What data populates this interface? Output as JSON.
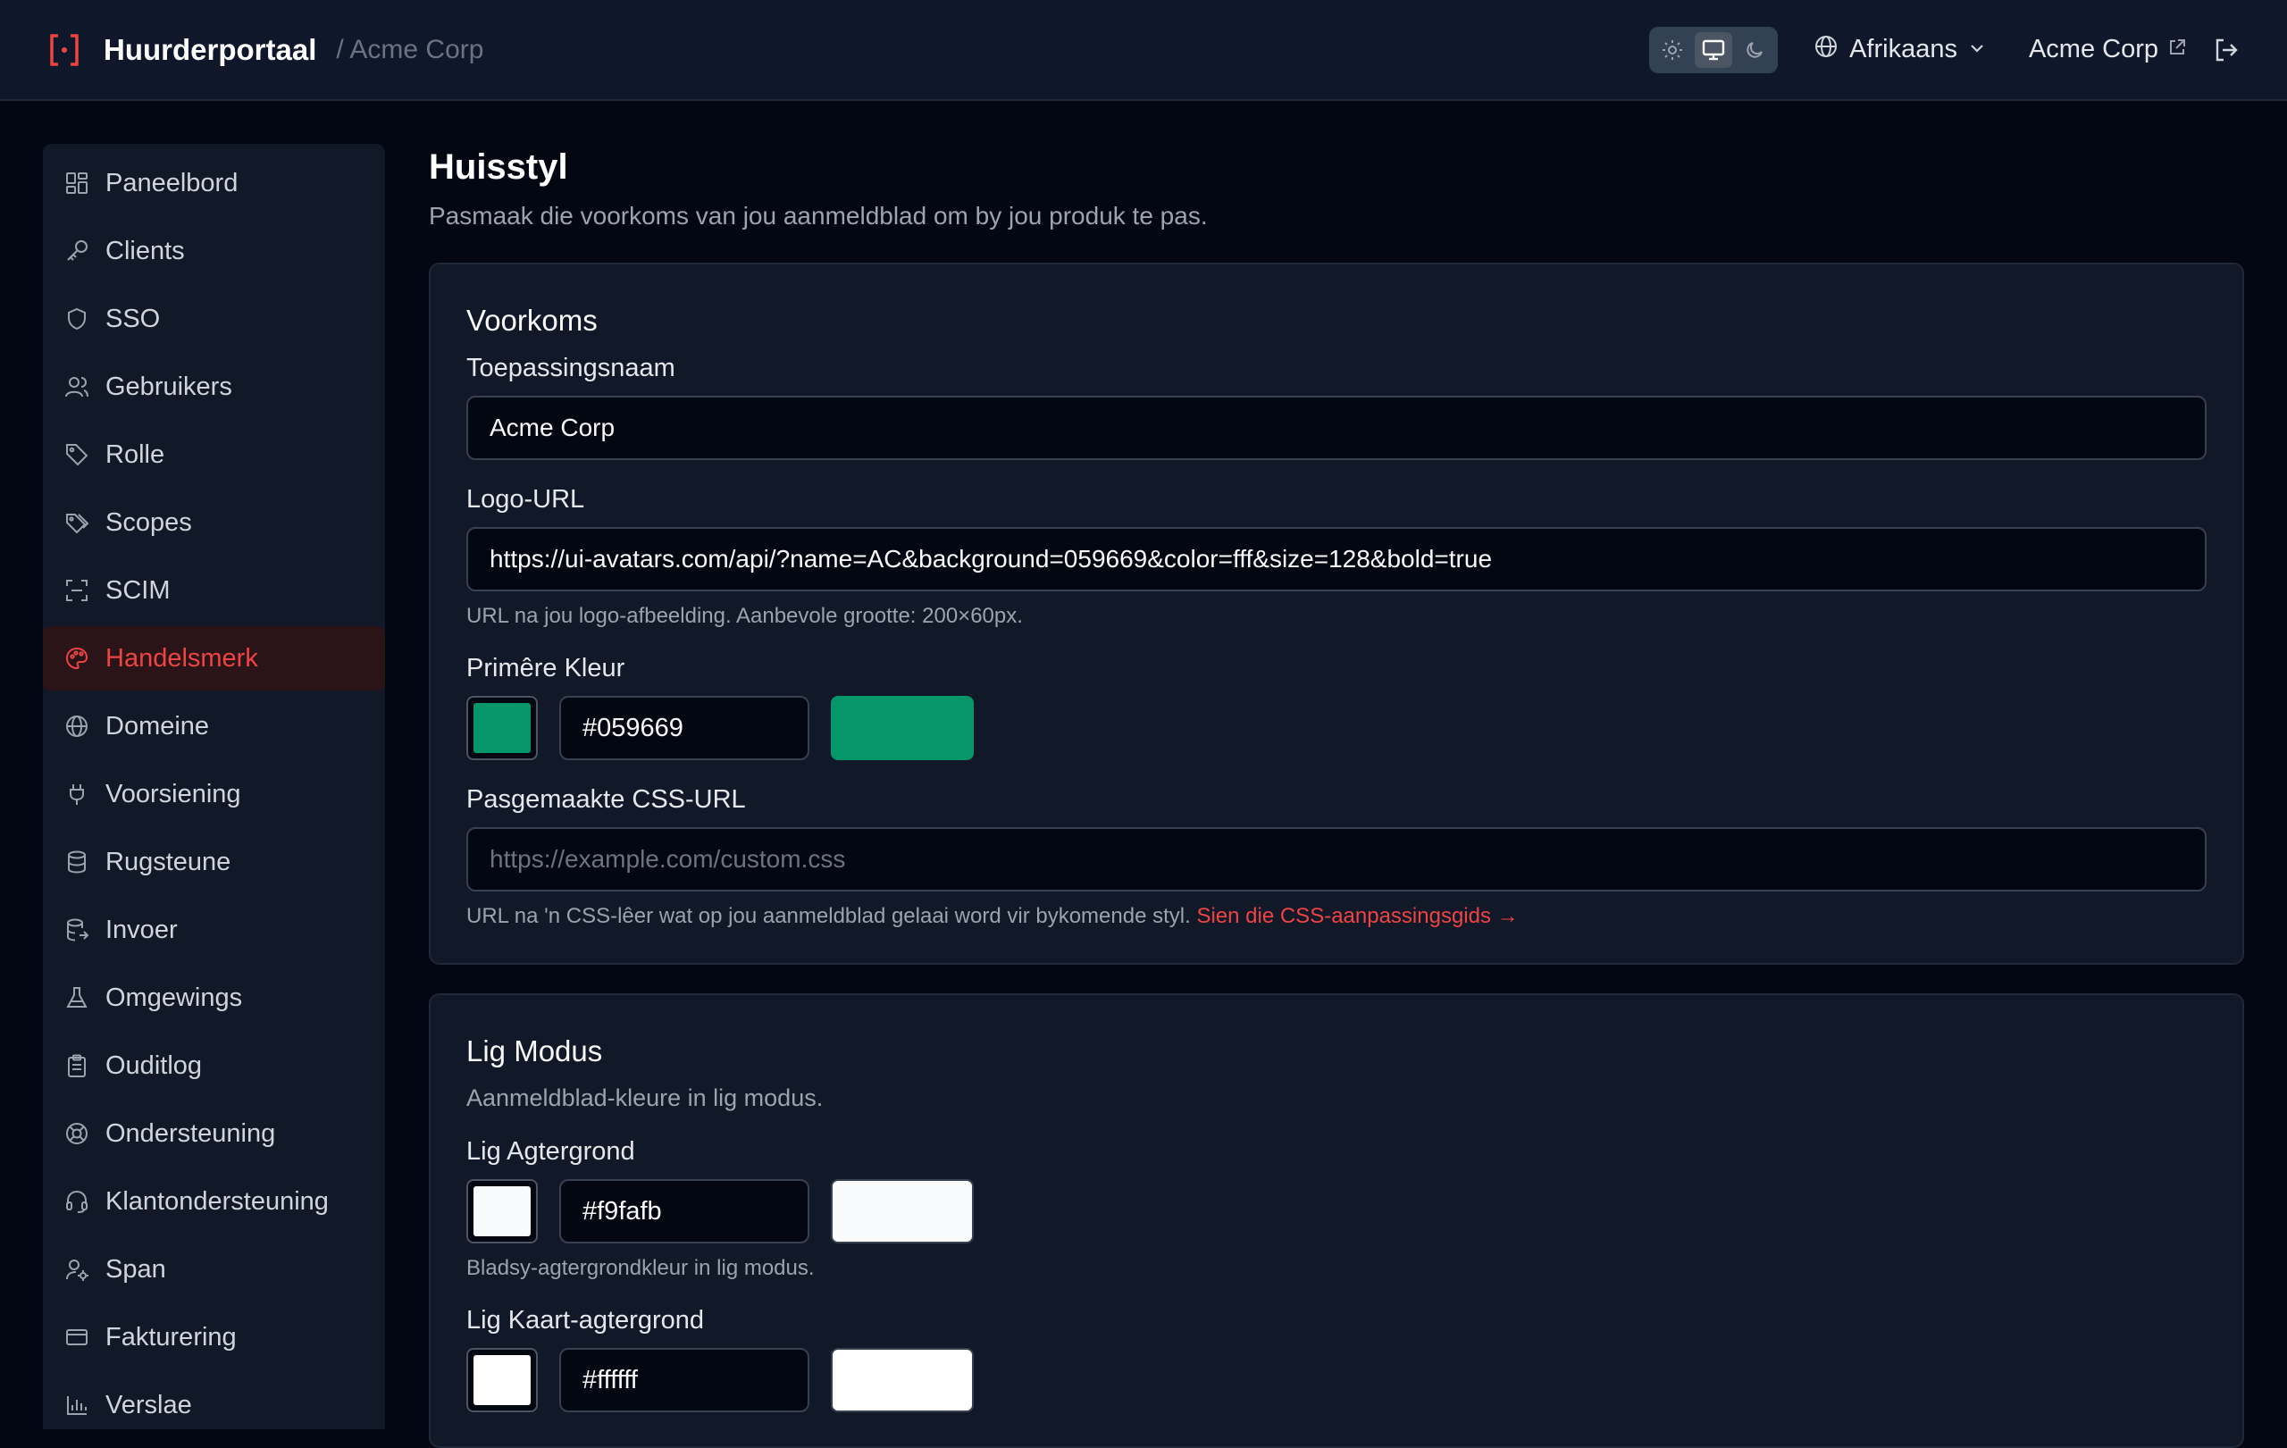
{
  "header": {
    "brand": "Huurderportaal",
    "breadcrumb": "/ Acme Corp",
    "language": "Afrikaans",
    "tenant": "Acme Corp",
    "accent": "#ef4444"
  },
  "sidebar": {
    "items": [
      {
        "label": "Paneelbord",
        "icon": "dashboard-icon"
      },
      {
        "label": "Clients",
        "icon": "key-icon"
      },
      {
        "label": "SSO",
        "icon": "shield-icon"
      },
      {
        "label": "Gebruikers",
        "icon": "users-icon"
      },
      {
        "label": "Rolle",
        "icon": "tag-icon"
      },
      {
        "label": "Scopes",
        "icon": "tags-icon"
      },
      {
        "label": "SCIM",
        "icon": "scan-icon"
      },
      {
        "label": "Handelsmerk",
        "icon": "palette-icon",
        "active": true
      },
      {
        "label": "Domeine",
        "icon": "globe-icon"
      },
      {
        "label": "Voorsiening",
        "icon": "plug-icon"
      },
      {
        "label": "Rugsteune",
        "icon": "database-icon"
      },
      {
        "label": "Invoer",
        "icon": "database-import-icon"
      },
      {
        "label": "Omgewings",
        "icon": "flask-icon"
      },
      {
        "label": "Ouditlog",
        "icon": "clipboard-icon"
      },
      {
        "label": "Ondersteuning",
        "icon": "lifebuoy-icon"
      },
      {
        "label": "Klantondersteuning",
        "icon": "headset-icon"
      },
      {
        "label": "Span",
        "icon": "user-cog-icon"
      },
      {
        "label": "Fakturering",
        "icon": "credit-card-icon"
      },
      {
        "label": "Verslae",
        "icon": "bar-chart-icon"
      }
    ]
  },
  "page": {
    "title": "Huisstyl",
    "subtitle": "Pasmaak die voorkoms van jou aanmeldblad om by jou produk te pas."
  },
  "appearance": {
    "title": "Voorkoms",
    "app_name_label": "Toepassingsnaam",
    "app_name_value": "Acme Corp",
    "logo_label": "Logo-URL",
    "logo_value": "https://ui-avatars.com/api/?name=AC&background=059669&color=fff&size=128&bold=true",
    "logo_hint": "URL na jou logo-afbeelding. Aanbevole grootte: 200×60px.",
    "primary_label": "Primêre Kleur",
    "primary_value": "#059669",
    "css_label": "Pasgemaakte CSS-URL",
    "css_placeholder": "https://example.com/custom.css",
    "css_hint": "URL na 'n CSS-lêer wat op jou aanmeldblad gelaai word vir bykomende styl.",
    "css_link": "Sien die CSS-aanpassingsgids →"
  },
  "light_mode": {
    "title": "Lig Modus",
    "desc": "Aanmeldblad-kleure in lig modus.",
    "bg_label": "Lig Agtergrond",
    "bg_value": "#f9fafb",
    "bg_hint": "Bladsy-agtergrondkleur in lig modus.",
    "card_label": "Lig Kaart-agtergrond",
    "card_value": "#ffffff"
  }
}
